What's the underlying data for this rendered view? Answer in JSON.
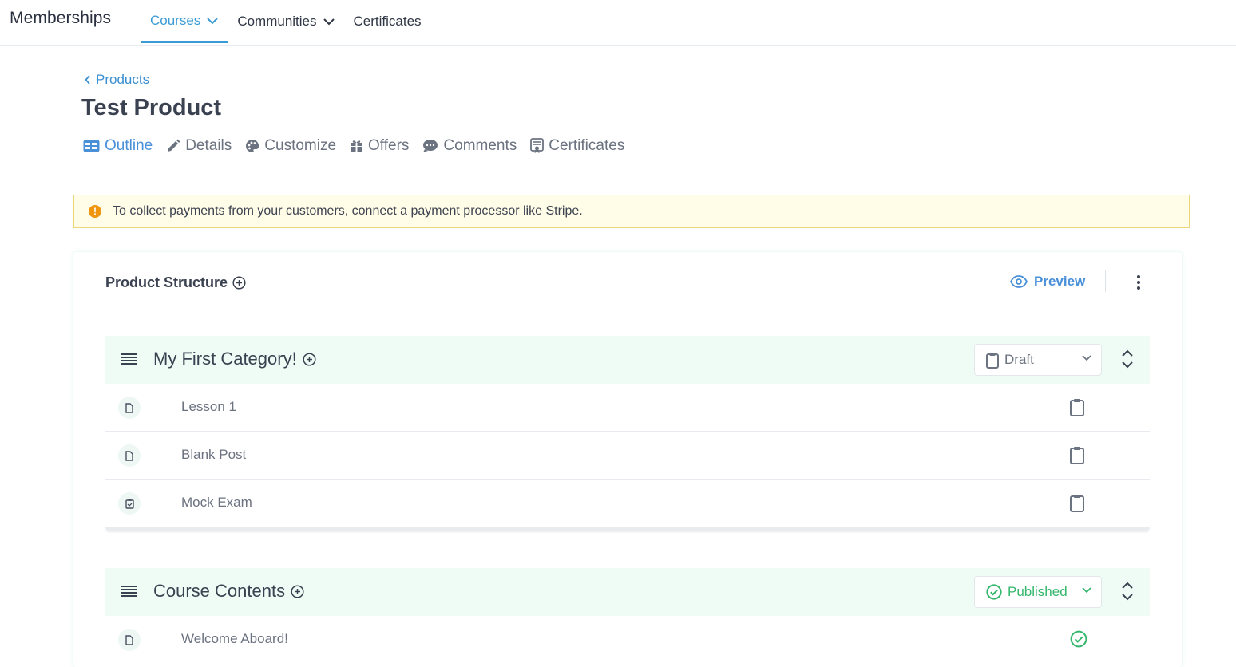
{
  "app": {
    "brand": "Memberships",
    "nav": [
      {
        "label": "Courses"
      },
      {
        "label": "Communities"
      },
      {
        "label": "Certificates"
      }
    ]
  },
  "breadcrumb": {
    "label": "Products"
  },
  "page": {
    "title": "Test Product",
    "tabs": [
      {
        "label": "Outline",
        "icon": "outline-icon"
      },
      {
        "label": "Details",
        "icon": "pencil-icon"
      },
      {
        "label": "Customize",
        "icon": "palette-icon"
      },
      {
        "label": "Offers",
        "icon": "gift-icon"
      },
      {
        "label": "Comments",
        "icon": "comment-icon"
      },
      {
        "label": "Certificates",
        "icon": "certificate-icon"
      }
    ]
  },
  "alert": {
    "text": "To collect payments from your customers, connect a payment processor like Stripe."
  },
  "structure": {
    "title": "Product Structure",
    "preview_label": "Preview",
    "categories": [
      {
        "name": "My First Category!",
        "status": "Draft",
        "lessons": [
          {
            "name": "Lesson 1",
            "type": "document-icon"
          },
          {
            "name": "Blank Post",
            "type": "document-icon"
          },
          {
            "name": "Mock Exam",
            "type": "quiz-icon"
          }
        ]
      },
      {
        "name": "Course Contents",
        "status": "Published",
        "lessons": [
          {
            "name": "Welcome Aboard!",
            "type": "document-icon"
          }
        ]
      }
    ]
  },
  "colors": {
    "accent": "#3a9bd5",
    "published": "#34b76c",
    "alert_bg": "#fffde8",
    "category_bg": "#effcf6"
  }
}
